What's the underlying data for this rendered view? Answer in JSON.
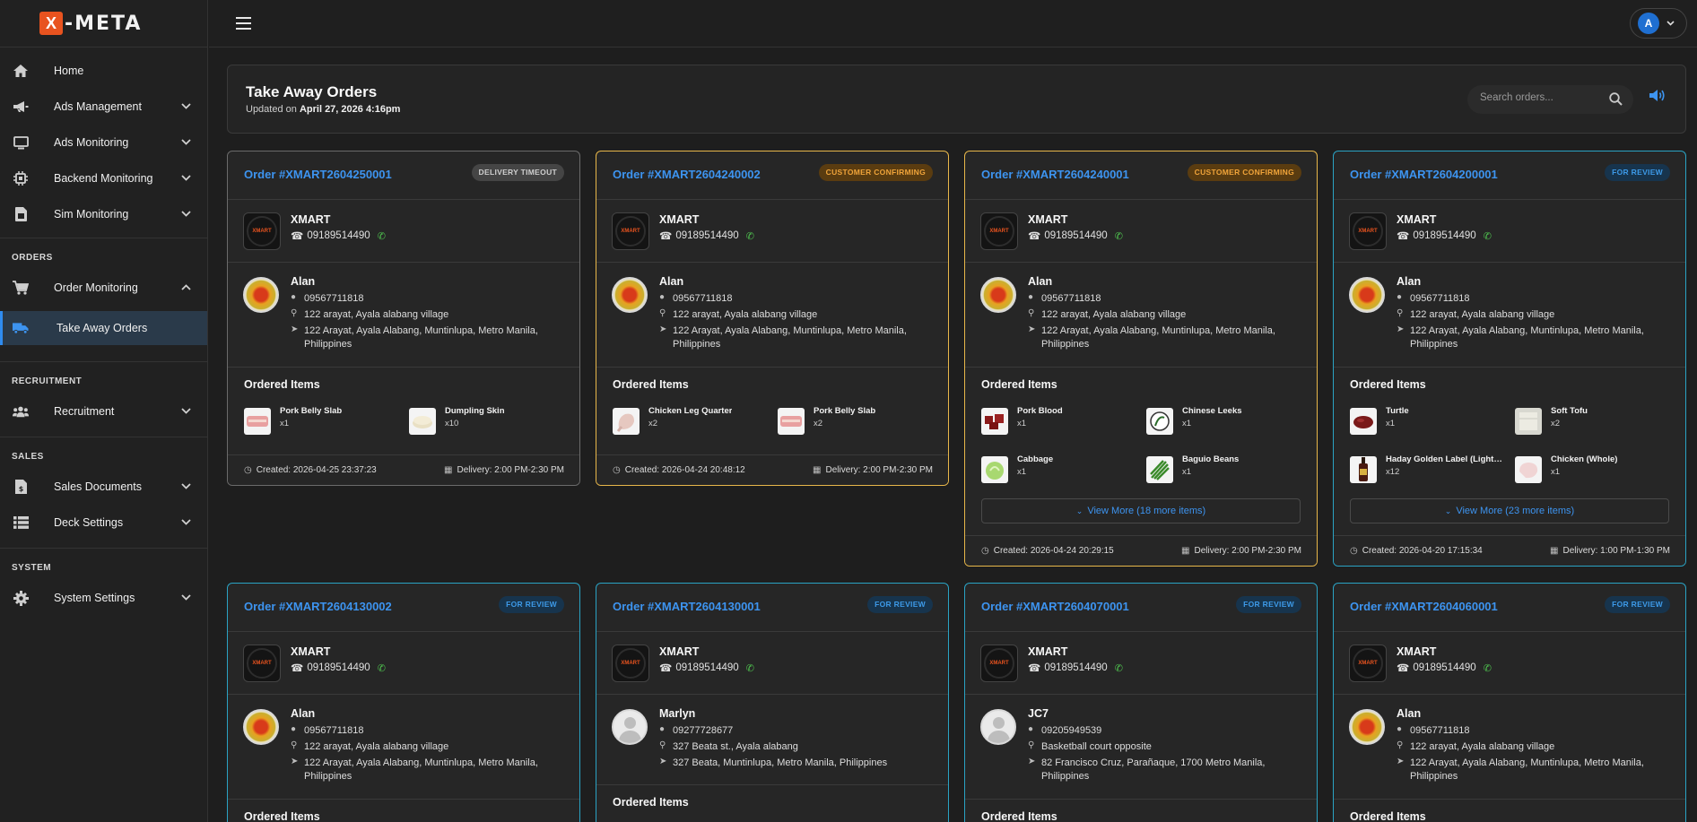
{
  "brand": {
    "mark": "X",
    "name": "-META"
  },
  "sidebar": {
    "items": [
      {
        "label": "Home",
        "icon": "home-icon"
      },
      {
        "label": "Ads Management",
        "icon": "megaphone-icon"
      },
      {
        "label": "Ads Monitoring",
        "icon": "monitor-icon"
      },
      {
        "label": "Backend Monitoring",
        "icon": "cpu-icon"
      },
      {
        "label": "Sim Monitoring",
        "icon": "sim-card-icon"
      }
    ],
    "sections": {
      "orders": "ORDERS",
      "recruitment": "RECRUITMENT",
      "sales": "SALES",
      "system": "SYSTEM"
    },
    "order_monitoring": "Order Monitoring",
    "take_away": "Take Away Orders",
    "recruitment": "Recruitment",
    "sales_documents": "Sales Documents",
    "deck_settings": "Deck Settings",
    "system_settings": "System Settings"
  },
  "user": {
    "initial": "A"
  },
  "header": {
    "title": "Take Away Orders",
    "updated_prefix": "Updated on",
    "updated_value": "April 27, 2026 4:16pm",
    "search_placeholder": "Search orders..."
  },
  "orders": [
    {
      "order_no": "Order #XMART2604250001",
      "status": "DELIVERY TIMEOUT",
      "store": {
        "name": "XMART",
        "phone": "09189514490"
      },
      "customer": {
        "name": "Alan",
        "phone": "09567711818",
        "landmark": "122 arayat, Ayala alabang village",
        "address": "122 Arayat, Ayala Alabang, Muntinlupa, Metro Manila, Philippines"
      },
      "items_title": "Ordered Items",
      "items": [
        {
          "name": "Pork Belly Slab",
          "qty": "x1"
        },
        {
          "name": "Dumpling Skin",
          "qty": "x10"
        }
      ],
      "created": "Created: 2026-04-25 23:37:23",
      "delivery": "Delivery: 2:00 PM-2:30 PM"
    },
    {
      "order_no": "Order #XMART2604240002",
      "status": "CUSTOMER CONFIRMING",
      "store": {
        "name": "XMART",
        "phone": "09189514490"
      },
      "customer": {
        "name": "Alan",
        "phone": "09567711818",
        "landmark": "122 arayat, Ayala alabang village",
        "address": "122 Arayat, Ayala Alabang, Muntinlupa, Metro Manila, Philippines"
      },
      "items_title": "Ordered Items",
      "items": [
        {
          "name": "Chicken Leg Quarter",
          "qty": "x2"
        },
        {
          "name": "Pork Belly Slab",
          "qty": "x2"
        }
      ],
      "created": "Created: 2026-04-24 20:48:12",
      "delivery": "Delivery: 2:00 PM-2:30 PM"
    },
    {
      "order_no": "Order #XMART2604240001",
      "status": "CUSTOMER CONFIRMING",
      "store": {
        "name": "XMART",
        "phone": "09189514490"
      },
      "customer": {
        "name": "Alan",
        "phone": "09567711818",
        "landmark": "122 arayat, Ayala alabang village",
        "address": "122 Arayat, Ayala Alabang, Muntinlupa, Metro Manila, Philippines"
      },
      "items_title": "Ordered Items",
      "items": [
        {
          "name": "Pork Blood",
          "qty": "x1"
        },
        {
          "name": "Chinese Leeks",
          "qty": "x1"
        },
        {
          "name": "Cabbage",
          "qty": "x1"
        },
        {
          "name": "Baguio Beans",
          "qty": "x1"
        }
      ],
      "view_more": "View More (18 more items)",
      "created": "Created: 2026-04-24 20:29:15",
      "delivery": "Delivery: 2:00 PM-2:30 PM"
    },
    {
      "order_no": "Order #XMART2604200001",
      "status": "FOR REVIEW",
      "store": {
        "name": "XMART",
        "phone": "09189514490"
      },
      "customer": {
        "name": "Alan",
        "phone": "09567711818",
        "landmark": "122 arayat, Ayala alabang village",
        "address": "122 Arayat, Ayala Alabang, Muntinlupa, Metro Manila, Philippines"
      },
      "items_title": "Ordered Items",
      "items": [
        {
          "name": "Turtle",
          "qty": "x1"
        },
        {
          "name": "Soft Tofu",
          "qty": "x2"
        },
        {
          "name": "Haday Golden Label (Light ...",
          "qty": "x12"
        },
        {
          "name": "Chicken (Whole)",
          "qty": "x1"
        }
      ],
      "view_more": "View More (23 more items)",
      "created": "Created: 2026-04-20 17:15:34",
      "delivery": "Delivery: 1:00 PM-1:30 PM"
    },
    {
      "order_no": "Order #XMART2604130002",
      "status": "FOR REVIEW",
      "store": {
        "name": "XMART",
        "phone": "09189514490"
      },
      "customer": {
        "name": "Alan",
        "phone": "09567711818",
        "landmark": "122 arayat, Ayala alabang village",
        "address": "122 Arayat, Ayala Alabang, Muntinlupa, Metro Manila, Philippines"
      },
      "items_title": "Ordered Items"
    },
    {
      "order_no": "Order #XMART2604130001",
      "status": "FOR REVIEW",
      "store": {
        "name": "XMART",
        "phone": "09189514490"
      },
      "customer": {
        "name": "Marlyn",
        "phone": "09277728677",
        "landmark": "327 Beata st., Ayala alabang",
        "address": "327 Beata, Muntinlupa, Metro Manila, Philippines"
      },
      "items_title": "Ordered Items"
    },
    {
      "order_no": "Order #XMART2604070001",
      "status": "FOR REVIEW",
      "store": {
        "name": "XMART",
        "phone": "09189514490"
      },
      "customer": {
        "name": "JC7",
        "phone": "09205949539",
        "landmark": "Basketball court opposite",
        "address": "82 Francisco Cruz, Parañaque, 1700 Metro Manila, Philippines"
      },
      "items_title": "Ordered Items"
    },
    {
      "order_no": "Order #XMART2604060001",
      "status": "FOR REVIEW",
      "store": {
        "name": "XMART",
        "phone": "09189514490"
      },
      "customer": {
        "name": "Alan",
        "phone": "09567711818",
        "landmark": "122 arayat, Ayala alabang village",
        "address": "122 Arayat, Ayala Alabang, Muntinlupa, Metro Manila, Philippines"
      },
      "items_title": "Ordered Items"
    }
  ],
  "colors": {
    "accent": "#3d94f0",
    "confirming": "#e8b74a",
    "review": "#2aa3c4",
    "timeout": "#6b6b6b",
    "call": "#4fc34f"
  }
}
